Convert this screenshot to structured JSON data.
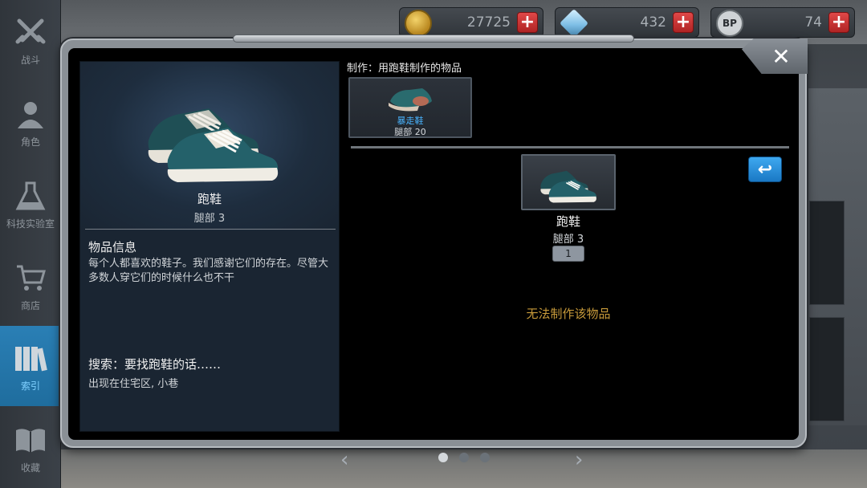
{
  "sidebar": {
    "items": [
      {
        "label": "战斗",
        "icon": "crossed-swords-icon"
      },
      {
        "label": "角色",
        "icon": "character-icon"
      },
      {
        "label": "科技实验室",
        "icon": "flask-icon"
      },
      {
        "label": "商店",
        "icon": "cart-icon"
      },
      {
        "label": "索引",
        "icon": "books-icon",
        "active": true
      },
      {
        "label": "收藏",
        "icon": "open-book-icon"
      }
    ]
  },
  "currency": {
    "gold": "27725",
    "crystals": "432",
    "bp": "74",
    "bp_label": "BP",
    "plus": "+"
  },
  "item": {
    "name": "跑鞋",
    "slot": "腿部 3",
    "info_title": "物品信息",
    "description": "每个人都喜欢的鞋子。我们感谢它们的存在。尽管大多数人穿它们的时候什么也不干",
    "search_title": "搜索：要找跑鞋的话……",
    "search_location": "出现在住宅区, 小巷"
  },
  "craft": {
    "header": "制作：用跑鞋制作的物品",
    "recipe_name": "暴走鞋",
    "recipe_slot": "腿部 20"
  },
  "selected": {
    "name": "跑鞋",
    "slot": "腿部 3",
    "quantity": "1",
    "status": "无法制作该物品"
  },
  "dialog": {
    "close_symbol": "✕",
    "back_symbol": "↩"
  },
  "pagination": {
    "prev": "‹",
    "next": "›",
    "current_page": 1,
    "total_pages": 3
  },
  "colors": {
    "active_tab": "#2a7fb5",
    "recipe_name": "#49b4ff",
    "cannot_craft": "#c79a3a",
    "plus_button": "#d23a3a"
  }
}
